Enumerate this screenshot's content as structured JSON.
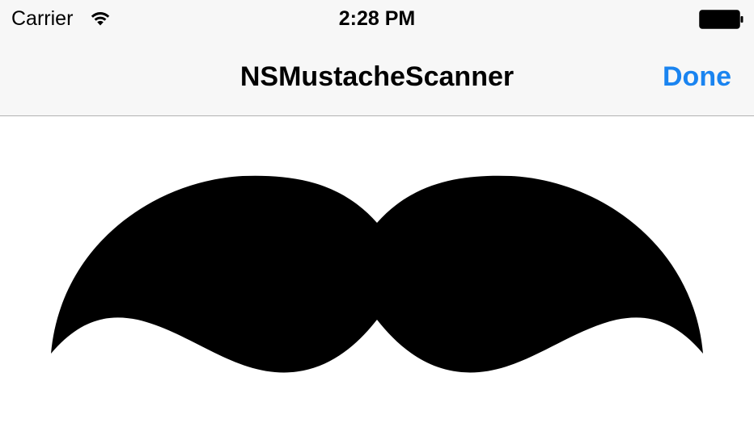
{
  "status_bar": {
    "carrier": "Carrier",
    "wifi_icon": "wifi-icon",
    "time": "2:28 PM",
    "battery_icon": "battery-icon"
  },
  "nav_bar": {
    "title": "NSMustacheScanner",
    "done_label": "Done"
  },
  "content": {
    "image_icon": "mustache-image"
  },
  "colors": {
    "accent": "#1a84f0",
    "bar_background": "#f7f7f7",
    "mustache": "#000000"
  }
}
